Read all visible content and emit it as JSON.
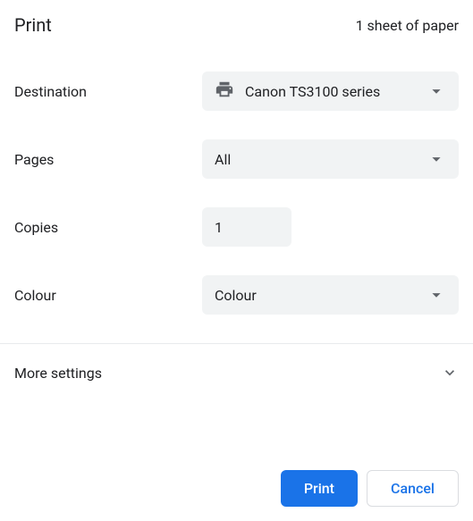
{
  "header": {
    "title": "Print",
    "summary": "1 sheet of paper"
  },
  "destination": {
    "label": "Destination",
    "value": "Canon TS3100 series"
  },
  "pages": {
    "label": "Pages",
    "value": "All"
  },
  "copies": {
    "label": "Copies",
    "value": "1"
  },
  "colour": {
    "label": "Colour",
    "value": "Colour"
  },
  "more_settings": {
    "label": "More settings"
  },
  "footer": {
    "print": "Print",
    "cancel": "Cancel"
  }
}
